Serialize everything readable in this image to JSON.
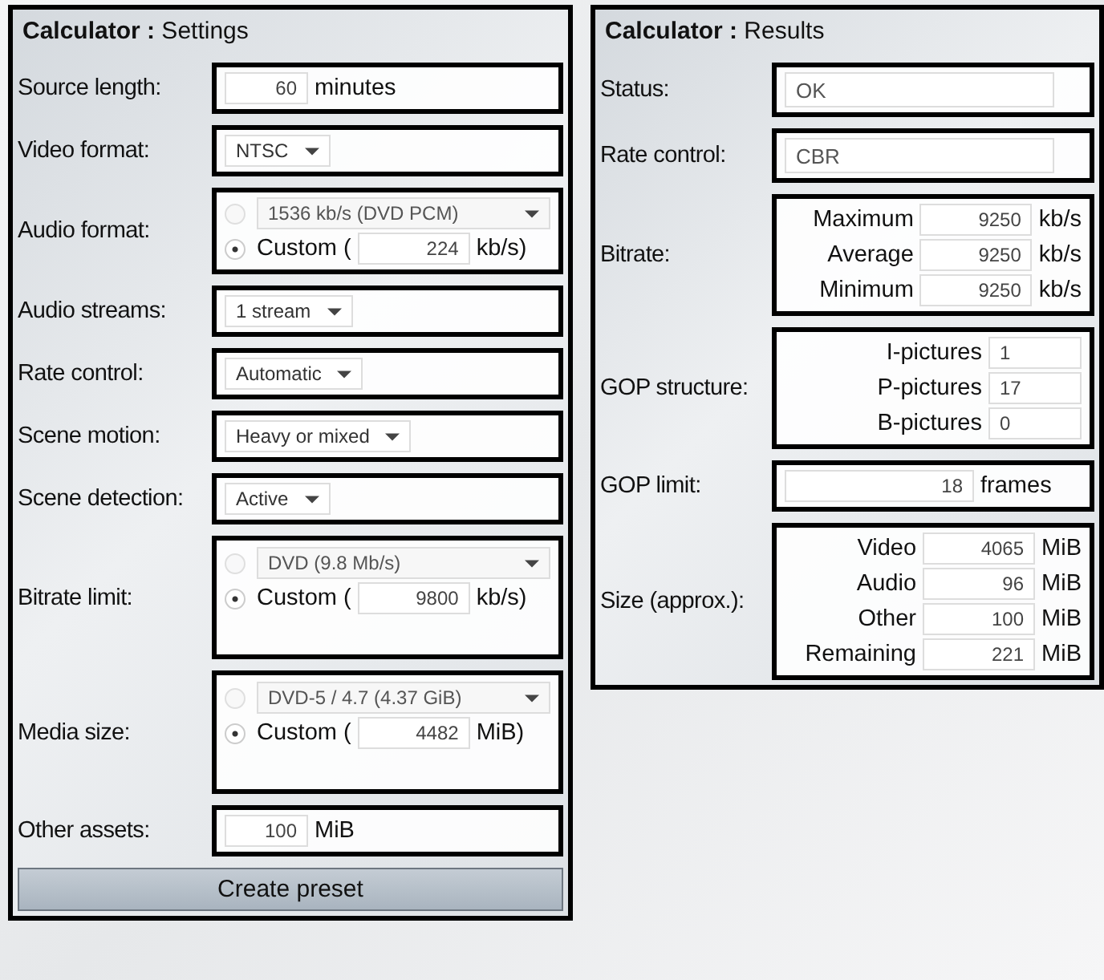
{
  "settings": {
    "title_bold": "Calculator :",
    "title": "Settings",
    "rows": [
      {
        "kind": "number",
        "label": "Source length:",
        "value": "60",
        "unit": "minutes"
      },
      {
        "kind": "select",
        "label": "Video format:",
        "value": "NTSC"
      },
      {
        "kind": "choice",
        "label": "Audio format:",
        "options": [
          {
            "kind": "preset",
            "value": "1536 kb/s (DVD PCM)",
            "selected": false
          },
          {
            "kind": "custom",
            "label": "Custom (",
            "value": "224",
            "unit": "kb/s)",
            "selected": true
          }
        ]
      },
      {
        "kind": "select",
        "label": "Audio streams:",
        "value": "1 stream"
      },
      {
        "kind": "select",
        "label": "Rate control:",
        "value": "Automatic"
      },
      {
        "kind": "select",
        "label": "Scene motion:",
        "value": "Heavy or mixed"
      },
      {
        "kind": "select",
        "label": "Scene detection:",
        "value": "Active"
      },
      {
        "kind": "choice",
        "label": "Bitrate limit:",
        "tall": true,
        "options": [
          {
            "kind": "preset",
            "value": "DVD (9.8 Mb/s)",
            "selected": false
          },
          {
            "kind": "custom",
            "label": "Custom (",
            "value": "9800",
            "unit": "kb/s)",
            "selected": true
          }
        ]
      },
      {
        "kind": "choice",
        "label": "Media size:",
        "tall": true,
        "options": [
          {
            "kind": "preset",
            "value": "DVD-5 / 4.7 (4.37 GiB)",
            "selected": false
          },
          {
            "kind": "custom",
            "label": "Custom (",
            "value": "4482",
            "unit": "MiB)",
            "selected": true
          }
        ]
      },
      {
        "kind": "number",
        "label": "Other assets:",
        "value": "100",
        "unit": "MiB"
      }
    ],
    "button": "Create preset"
  },
  "results": {
    "title_bold": "Calculator :",
    "title": "Results",
    "rows": [
      {
        "kind": "text",
        "label": "Status:",
        "value": "OK"
      },
      {
        "kind": "text",
        "label": "Rate control:",
        "value": "CBR"
      },
      {
        "kind": "multi",
        "label": "Bitrate:",
        "fields": [
          {
            "label": "Maximum",
            "value": "9250",
            "unit": "kb/s"
          },
          {
            "label": "Average",
            "value": "9250",
            "unit": "kb/s"
          },
          {
            "label": "Minimum",
            "value": "9250",
            "unit": "kb/s"
          }
        ]
      },
      {
        "kind": "gop",
        "label": "GOP structure:",
        "fields": [
          {
            "label": "I-pictures",
            "value": "1"
          },
          {
            "label": "P-pictures",
            "value": "17"
          },
          {
            "label": "B-pictures",
            "value": "0"
          }
        ]
      },
      {
        "kind": "number",
        "label": "GOP limit:",
        "value": "18",
        "unit": "frames"
      },
      {
        "kind": "multi",
        "label": "Size (approx.):",
        "fields": [
          {
            "label": "Video",
            "value": "4065",
            "unit": "MiB"
          },
          {
            "label": "Audio",
            "value": "96",
            "unit": "MiB"
          },
          {
            "label": "Other",
            "value": "100",
            "unit": "MiB"
          },
          {
            "label": "Remaining",
            "value": "221",
            "unit": "MiB"
          }
        ]
      }
    ]
  }
}
